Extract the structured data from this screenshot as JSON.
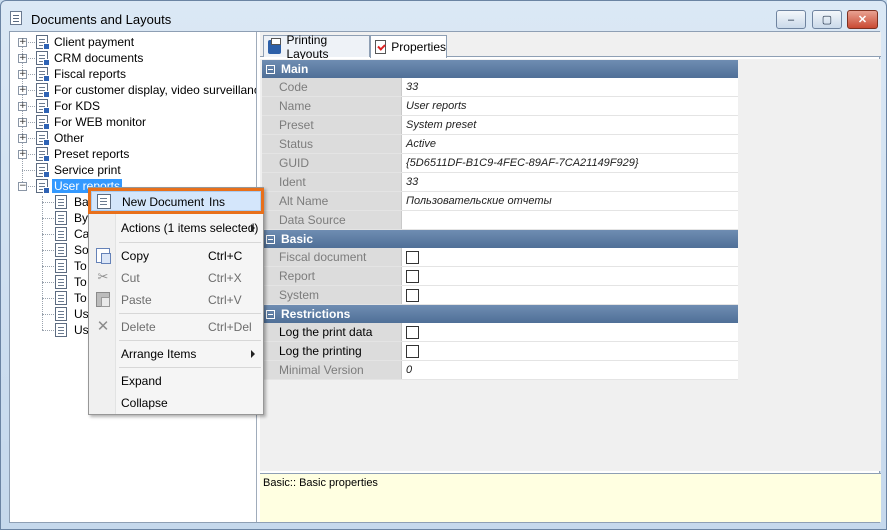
{
  "window": {
    "title": "Documents and Layouts",
    "minimize_glyph": "–",
    "maximize_glyph": "▢",
    "close_glyph": "✕"
  },
  "tree": {
    "items": [
      {
        "label": "Client payment",
        "expanded": false
      },
      {
        "label": "CRM documents",
        "expanded": false
      },
      {
        "label": "Fiscal reports",
        "expanded": false
      },
      {
        "label": "For customer display, video surveillance",
        "expanded": false
      },
      {
        "label": "For KDS",
        "expanded": false
      },
      {
        "label": "For WEB monitor",
        "expanded": false
      },
      {
        "label": "Other",
        "expanded": false
      },
      {
        "label": "Preset reports",
        "expanded": false
      },
      {
        "label": "Service print",
        "expanded": null
      },
      {
        "label": "User reports",
        "expanded": true,
        "selected": true
      }
    ],
    "children": [
      "Ba",
      "By",
      "Ca",
      "So",
      "To",
      "To",
      "To",
      "Us",
      "Us"
    ],
    "expand_glyph": "+",
    "collapse_glyph": "−"
  },
  "tabs": [
    {
      "label": "Printing Layouts",
      "icon": "printer-icon",
      "active": false
    },
    {
      "label": "Properties",
      "icon": "properties-icon",
      "active": true
    }
  ],
  "properties": {
    "main": {
      "title": "Main",
      "rows": [
        {
          "name": "Code",
          "value": "33"
        },
        {
          "name": "Name",
          "value": "User reports"
        },
        {
          "name": "Preset",
          "value": "System preset"
        },
        {
          "name": "Status",
          "value": "Active"
        },
        {
          "name": "GUID",
          "value": "{5D6511DF-B1C9-4FEC-89AF-7CA21149F929}"
        },
        {
          "name": "Ident",
          "value": "33"
        },
        {
          "name": "Alt Name",
          "value": "Пользовательские отчеты"
        },
        {
          "name": "Data Source",
          "value": ""
        }
      ]
    },
    "basic": {
      "title": "Basic",
      "rows": [
        {
          "name": "Fiscal document",
          "checked": false
        },
        {
          "name": "Report",
          "checked": false
        },
        {
          "name": "System",
          "checked": false
        }
      ]
    },
    "restrictions": {
      "title": "Restrictions",
      "rows": [
        {
          "name": "Log the print data",
          "checked": false
        },
        {
          "name": "Log the printing",
          "checked": false
        },
        {
          "name": "Minimal Version",
          "value": "0"
        }
      ]
    }
  },
  "description": "Basic:: Basic properties",
  "context_menu": {
    "new_document": {
      "label": "New Document",
      "shortcut": "Ins"
    },
    "actions": {
      "label": "Actions (1 items selected)"
    },
    "copy": {
      "label": "Copy",
      "shortcut": "Ctrl+C"
    },
    "cut": {
      "label": "Cut",
      "shortcut": "Ctrl+X"
    },
    "paste": {
      "label": "Paste",
      "shortcut": "Ctrl+V"
    },
    "delete": {
      "label": "Delete",
      "shortcut": "Ctrl+Del"
    },
    "arrange": {
      "label": "Arrange Items"
    },
    "expand": {
      "label": "Expand"
    },
    "collapse": {
      "label": "Collapse"
    }
  },
  "colors": {
    "highlight_frame": "#e8701b",
    "section_header": "#5a789f",
    "selection": "#3399ff"
  }
}
